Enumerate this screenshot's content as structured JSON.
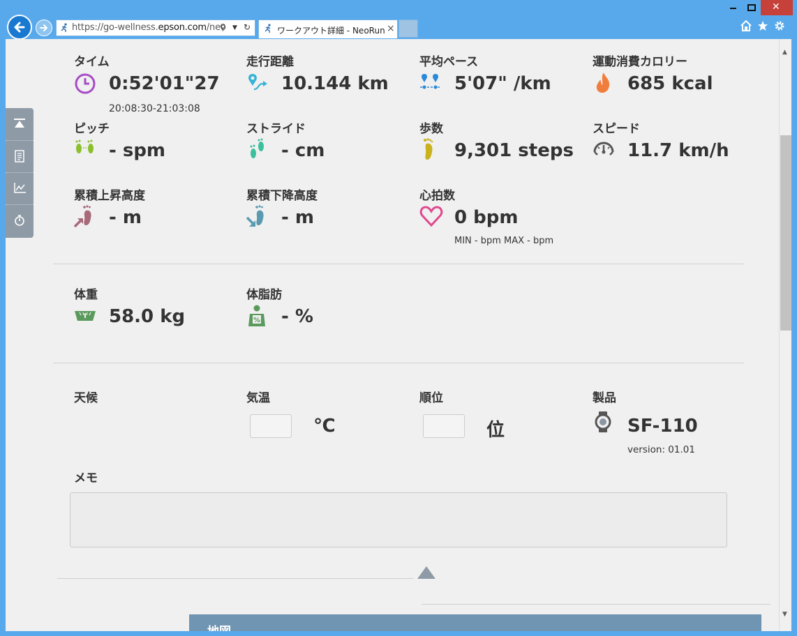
{
  "browser": {
    "url_prefix": "https://go-wellness.",
    "url_domain": "epson.com",
    "url_suffix": "/neo",
    "tab_title": "ワークアウト詳細 - NeoRun",
    "tab_close": "×"
  },
  "workout": {
    "time": {
      "label": "タイム",
      "value": "0:52'01\"27",
      "sub": "20:08:30-21:03:08"
    },
    "distance": {
      "label": "走行距離",
      "value": "10.144 km"
    },
    "pace": {
      "label": "平均ペース",
      "value": "5'07\" /km"
    },
    "calories": {
      "label": "運動消費カロリー",
      "value": "685 kcal"
    },
    "pitch": {
      "label": "ピッチ",
      "value": "- spm"
    },
    "stride": {
      "label": "ストライド",
      "value": "- cm"
    },
    "steps": {
      "label": "歩数",
      "value": "9,301 steps"
    },
    "speed": {
      "label": "スピード",
      "value": "11.7 km/h"
    },
    "ascent": {
      "label": "累積上昇高度",
      "value": "- m"
    },
    "descent": {
      "label": "累積下降高度",
      "value": "- m"
    },
    "heart_rate": {
      "label": "心拍数",
      "value": "0 bpm",
      "sub": "MIN - bpm MAX - bpm"
    }
  },
  "body": {
    "weight": {
      "label": "体重",
      "value": "58.0 kg"
    },
    "body_fat": {
      "label": "体脂肪",
      "value": "- %"
    }
  },
  "conditions": {
    "weather": {
      "label": "天候"
    },
    "temperature": {
      "label": "気温",
      "input_value": "",
      "unit": "℃"
    },
    "rank": {
      "label": "順位",
      "input_value": "",
      "unit": "位"
    },
    "product": {
      "label": "製品",
      "value": "SF-110",
      "sub": "version: 01.01"
    }
  },
  "memo": {
    "label": "メモ",
    "value": ""
  },
  "map": {
    "label": "地図"
  },
  "colors": {
    "titlebar": "#58a9ec",
    "content_bg": "#f0f0f0",
    "sidenav": "#8e9aa5",
    "map_header": "#6f95b2",
    "time_icon": "#a64bc6",
    "distance_icon": "#35b2d6",
    "pace_icon": "#2a8ad8",
    "calorie_icon": "#f07d3c",
    "pitch_icon": "#8cbf2c",
    "stride_icon": "#3cbf9c",
    "steps_icon": "#c9b21c",
    "ascent_icon": "#a86a7a",
    "descent_icon": "#5a9ab0",
    "heart_icon": "#e0488e",
    "weight_icon": "#5a9a5c",
    "fat_icon": "#5a9a5c"
  },
  "icons": [
    "back-icon",
    "forward-icon",
    "search-icon",
    "dropdown-icon",
    "refresh-icon",
    "home-icon",
    "favorites-icon",
    "settings-icon",
    "scroll-top-icon",
    "document-icon",
    "chart-icon",
    "stopwatch-icon",
    "clock-icon",
    "map-pin-icon",
    "pace-icon",
    "flame-icon",
    "footprints-icon",
    "footprint-icon",
    "speedometer-icon",
    "ascent-icon",
    "descent-icon",
    "heart-icon",
    "scale-icon",
    "body-fat-icon",
    "watch-icon"
  ]
}
